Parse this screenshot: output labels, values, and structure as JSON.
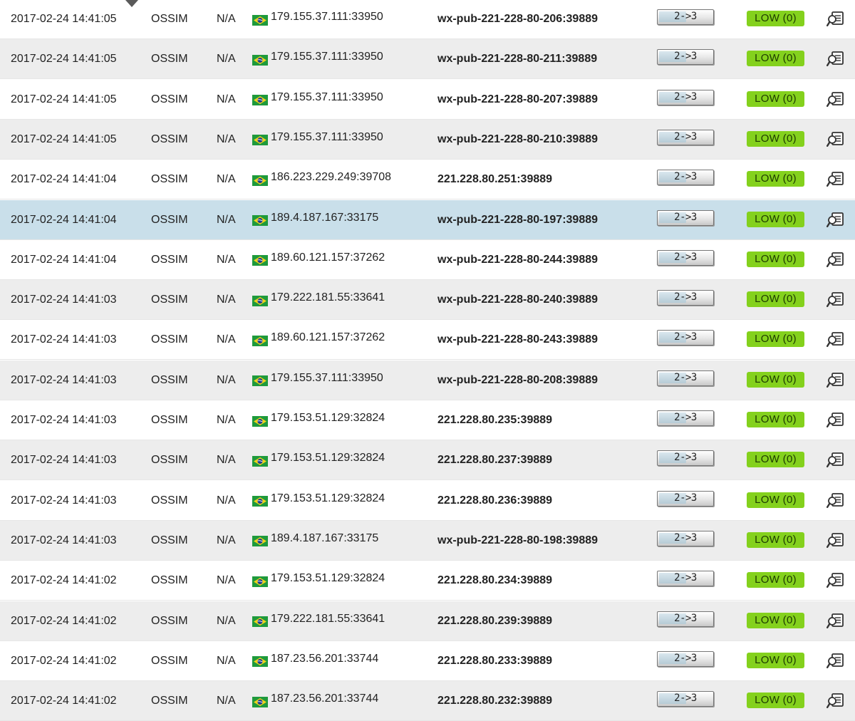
{
  "rows": [
    {
      "date": "2017-02-24 14:41:05",
      "sensor": "OSSIM",
      "otx": "N/A",
      "src_flag": "brazil-flag-icon",
      "src": "179.155.37.111:33950",
      "dst": "wx-pub-221-228-80-206:39889",
      "asset": "2->3",
      "risk": "LOW  (0)",
      "selected": false
    },
    {
      "date": "2017-02-24 14:41:05",
      "sensor": "OSSIM",
      "otx": "N/A",
      "src_flag": "brazil-flag-icon",
      "src": "179.155.37.111:33950",
      "dst": "wx-pub-221-228-80-211:39889",
      "asset": "2->3",
      "risk": "LOW  (0)",
      "selected": false
    },
    {
      "date": "2017-02-24 14:41:05",
      "sensor": "OSSIM",
      "otx": "N/A",
      "src_flag": "brazil-flag-icon",
      "src": "179.155.37.111:33950",
      "dst": "wx-pub-221-228-80-207:39889",
      "asset": "2->3",
      "risk": "LOW  (0)",
      "selected": false
    },
    {
      "date": "2017-02-24 14:41:05",
      "sensor": "OSSIM",
      "otx": "N/A",
      "src_flag": "brazil-flag-icon",
      "src": "179.155.37.111:33950",
      "dst": "wx-pub-221-228-80-210:39889",
      "asset": "2->3",
      "risk": "LOW  (0)",
      "selected": false
    },
    {
      "date": "2017-02-24 14:41:04",
      "sensor": "OSSIM",
      "otx": "N/A",
      "src_flag": "brazil-flag-icon",
      "src": "186.223.229.249:39708",
      "dst": "221.228.80.251:39889",
      "asset": "2->3",
      "risk": "LOW  (0)",
      "selected": false
    },
    {
      "date": "2017-02-24 14:41:04",
      "sensor": "OSSIM",
      "otx": "N/A",
      "src_flag": "brazil-flag-icon",
      "src": "189.4.187.167:33175",
      "dst": "wx-pub-221-228-80-197:39889",
      "asset": "2->3",
      "risk": "LOW  (0)",
      "selected": true
    },
    {
      "date": "2017-02-24 14:41:04",
      "sensor": "OSSIM",
      "otx": "N/A",
      "src_flag": "brazil-flag-icon",
      "src": "189.60.121.157:37262",
      "dst": "wx-pub-221-228-80-244:39889",
      "asset": "2->3",
      "risk": "LOW  (0)",
      "selected": false
    },
    {
      "date": "2017-02-24 14:41:03",
      "sensor": "OSSIM",
      "otx": "N/A",
      "src_flag": "brazil-flag-icon",
      "src": "179.222.181.55:33641",
      "dst": "wx-pub-221-228-80-240:39889",
      "asset": "2->3",
      "risk": "LOW  (0)",
      "selected": false
    },
    {
      "date": "2017-02-24 14:41:03",
      "sensor": "OSSIM",
      "otx": "N/A",
      "src_flag": "brazil-flag-icon",
      "src": "189.60.121.157:37262",
      "dst": "wx-pub-221-228-80-243:39889",
      "asset": "2->3",
      "risk": "LOW  (0)",
      "selected": false
    },
    {
      "date": "2017-02-24 14:41:03",
      "sensor": "OSSIM",
      "otx": "N/A",
      "src_flag": "brazil-flag-icon",
      "src": "179.155.37.111:33950",
      "dst": "wx-pub-221-228-80-208:39889",
      "asset": "2->3",
      "risk": "LOW  (0)",
      "selected": false
    },
    {
      "date": "2017-02-24 14:41:03",
      "sensor": "OSSIM",
      "otx": "N/A",
      "src_flag": "brazil-flag-icon",
      "src": "179.153.51.129:32824",
      "dst": "221.228.80.235:39889",
      "asset": "2->3",
      "risk": "LOW  (0)",
      "selected": false
    },
    {
      "date": "2017-02-24 14:41:03",
      "sensor": "OSSIM",
      "otx": "N/A",
      "src_flag": "brazil-flag-icon",
      "src": "179.153.51.129:32824",
      "dst": "221.228.80.237:39889",
      "asset": "2->3",
      "risk": "LOW  (0)",
      "selected": false
    },
    {
      "date": "2017-02-24 14:41:03",
      "sensor": "OSSIM",
      "otx": "N/A",
      "src_flag": "brazil-flag-icon",
      "src": "179.153.51.129:32824",
      "dst": "221.228.80.236:39889",
      "asset": "2->3",
      "risk": "LOW  (0)",
      "selected": false
    },
    {
      "date": "2017-02-24 14:41:03",
      "sensor": "OSSIM",
      "otx": "N/A",
      "src_flag": "brazil-flag-icon",
      "src": "189.4.187.167:33175",
      "dst": "wx-pub-221-228-80-198:39889",
      "asset": "2->3",
      "risk": "LOW  (0)",
      "selected": false
    },
    {
      "date": "2017-02-24 14:41:02",
      "sensor": "OSSIM",
      "otx": "N/A",
      "src_flag": "brazil-flag-icon",
      "src": "179.153.51.129:32824",
      "dst": "221.228.80.234:39889",
      "asset": "2->3",
      "risk": "LOW  (0)",
      "selected": false
    },
    {
      "date": "2017-02-24 14:41:02",
      "sensor": "OSSIM",
      "otx": "N/A",
      "src_flag": "brazil-flag-icon",
      "src": "179.222.181.55:33641",
      "dst": "221.228.80.239:39889",
      "asset": "2->3",
      "risk": "LOW  (0)",
      "selected": false
    },
    {
      "date": "2017-02-24 14:41:02",
      "sensor": "OSSIM",
      "otx": "N/A",
      "src_flag": "brazil-flag-icon",
      "src": "187.23.56.201:33744",
      "dst": "221.228.80.233:39889",
      "asset": "2->3",
      "risk": "LOW  (0)",
      "selected": false
    },
    {
      "date": "2017-02-24 14:41:02",
      "sensor": "OSSIM",
      "otx": "N/A",
      "src_flag": "brazil-flag-icon",
      "src": "187.23.56.201:33744",
      "dst": "221.228.80.232:39889",
      "asset": "2->3",
      "risk": "LOW  (0)",
      "selected": false
    }
  ],
  "colors": {
    "row_odd": "#ffffff",
    "row_even": "#ededed",
    "row_selected": "#c9dfea",
    "risk_low": "#84d11d",
    "asset_fill": "#b6cbd6"
  },
  "icons": {
    "sort_caret": "caret-down-icon",
    "detail": "event-detail-icon",
    "flag": "brazil-flag-icon"
  }
}
